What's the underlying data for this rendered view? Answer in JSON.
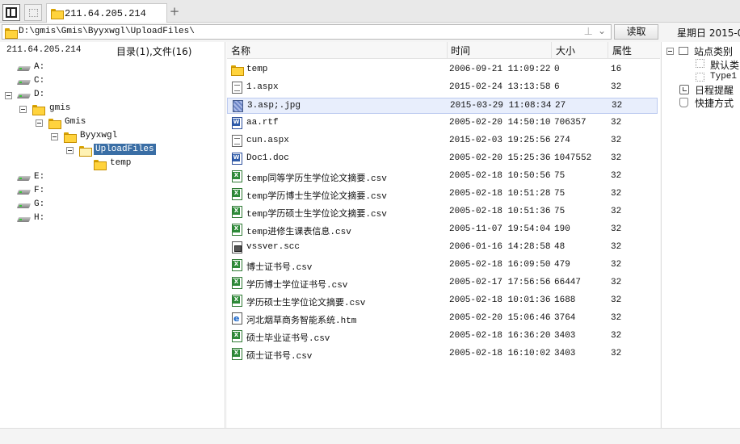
{
  "tabs": {
    "active_title": "211.64.205.214",
    "add_label": "+"
  },
  "address": {
    "path": "D:\\gmis\\Gmis\\Byyxwgl\\UploadFiles\\",
    "pin_glyph": "⊥",
    "read_button": "读取",
    "date_label": "星期日 2015-0"
  },
  "left": {
    "host": "211.64.205.214",
    "summary": "目录(1),文件(16)",
    "tree": [
      "A:",
      "C:",
      "D:",
      "gmis",
      "Gmis",
      "Byyxwgl",
      "UploadFiles",
      "temp",
      "E:",
      "F:",
      "G:",
      "H:"
    ]
  },
  "list": {
    "headers": {
      "name": "名称",
      "time": "时间",
      "size": "大小",
      "attr": "属性"
    },
    "rows": [
      {
        "icon": "folder-icon",
        "name": "temp",
        "time": "2006-09-21 11:09:22",
        "size": "0",
        "attr": "16"
      },
      {
        "icon": "text-file-icon",
        "name": "1.aspx",
        "time": "2015-02-24 13:13:58",
        "size": "6",
        "attr": "32"
      },
      {
        "icon": "image-file-icon",
        "name": "3.asp;.jpg",
        "time": "2015-03-29 11:08:34",
        "size": "27",
        "attr": "32",
        "selected": true
      },
      {
        "icon": "word-file-icon",
        "name": "aa.rtf",
        "time": "2005-02-20 14:50:10",
        "size": "706357",
        "attr": "32"
      },
      {
        "icon": "text-file-icon",
        "name": "cun.aspx",
        "time": "2015-02-03 19:25:56",
        "size": "274",
        "attr": "32"
      },
      {
        "icon": "word-file-icon",
        "name": "Doc1.doc",
        "time": "2005-02-20 15:25:36",
        "size": "1047552",
        "attr": "32"
      },
      {
        "icon": "excel-file-icon",
        "name": "temp同等学历生学位论文摘要.csv",
        "time": "2005-02-18 10:50:56",
        "size": "75",
        "attr": "32"
      },
      {
        "icon": "excel-file-icon",
        "name": "temp学历博士生学位论文摘要.csv",
        "time": "2005-02-18 10:51:28",
        "size": "75",
        "attr": "32"
      },
      {
        "icon": "excel-file-icon",
        "name": "temp学历硕士生学位论文摘要.csv",
        "time": "2005-02-18 10:51:36",
        "size": "75",
        "attr": "32"
      },
      {
        "icon": "excel-file-icon",
        "name": "temp进修生课表信息.csv",
        "time": "2005-11-07 19:54:04",
        "size": "190",
        "attr": "32"
      },
      {
        "icon": "system-file-icon",
        "name": "vssver.scc",
        "time": "2006-01-16 14:28:58",
        "size": "48",
        "attr": "32"
      },
      {
        "icon": "excel-file-icon",
        "name": "博士证书号.csv",
        "time": "2005-02-18 16:09:50",
        "size": "479",
        "attr": "32"
      },
      {
        "icon": "excel-file-icon",
        "name": "学历博士学位证书号.csv",
        "time": "2005-02-17 17:56:56",
        "size": "66447",
        "attr": "32"
      },
      {
        "icon": "excel-file-icon",
        "name": "学历硕士生学位论文摘要.csv",
        "time": "2005-02-18 10:01:36",
        "size": "1688",
        "attr": "32"
      },
      {
        "icon": "html-file-icon",
        "name": "河北烟草商务智能系统.htm",
        "time": "2005-02-20 15:06:46",
        "size": "3764",
        "attr": "32"
      },
      {
        "icon": "excel-file-icon",
        "name": "硕士毕业证书号.csv",
        "time": "2005-02-18 16:36:20",
        "size": "3403",
        "attr": "32"
      },
      {
        "icon": "excel-file-icon",
        "name": "硕士证书号.csv",
        "time": "2005-02-18 16:10:02",
        "size": "3403",
        "attr": "32"
      }
    ]
  },
  "right": {
    "items": [
      "站点类别",
      "默认类",
      "Type1",
      "日程提醒",
      "快捷方式"
    ]
  }
}
